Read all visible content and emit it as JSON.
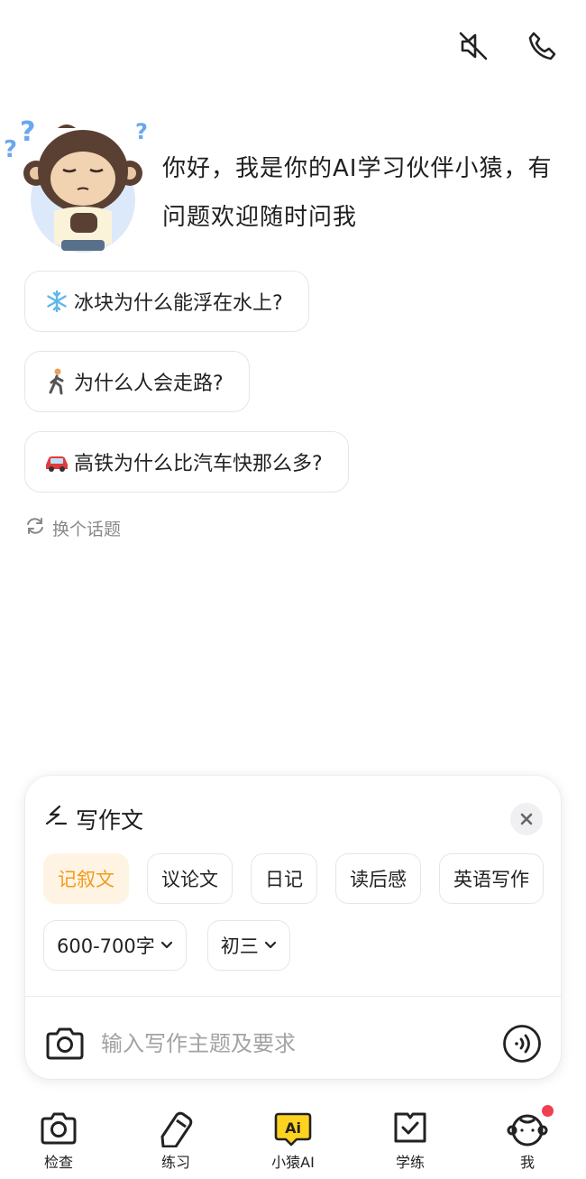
{
  "top_bar": {
    "icons": [
      "speaker-muted-icon",
      "phone-icon"
    ]
  },
  "greeting": {
    "text": "你好，我是你的AI学习伙伴小猿，有问题欢迎随时问我",
    "avatar": "monkey-mascot"
  },
  "suggestions": [
    {
      "emoji": "snowflake",
      "text": "冰块为什么能浮在水上?"
    },
    {
      "emoji": "person-walking",
      "text": "为什么人会走路?"
    },
    {
      "emoji": "red-car",
      "text": "高铁为什么比汽车快那么多?"
    }
  ],
  "refresh": {
    "label": "换个话题"
  },
  "writing_panel": {
    "title": "写作文",
    "genres": [
      "记叙文",
      "议论文",
      "日记",
      "读后感",
      "英语写作"
    ],
    "selected_genre": "记叙文",
    "word_count": "600-700字",
    "grade": "初三",
    "input_placeholder": "输入写作主题及要求"
  },
  "tabbar": {
    "items": [
      {
        "label": "检查",
        "icon": "camera-icon"
      },
      {
        "label": "练习",
        "icon": "pencil-icon"
      },
      {
        "label": "小猿AI",
        "icon": "ai-icon",
        "active": true
      },
      {
        "label": "学练",
        "icon": "check-book-icon"
      },
      {
        "label": "我",
        "icon": "profile-icon",
        "badge": true
      }
    ]
  },
  "colors": {
    "accent": "#f29b1e",
    "accent_bg": "#fff4e3",
    "badge": "#f0404f",
    "ai_yellow": "#ffd21f"
  }
}
